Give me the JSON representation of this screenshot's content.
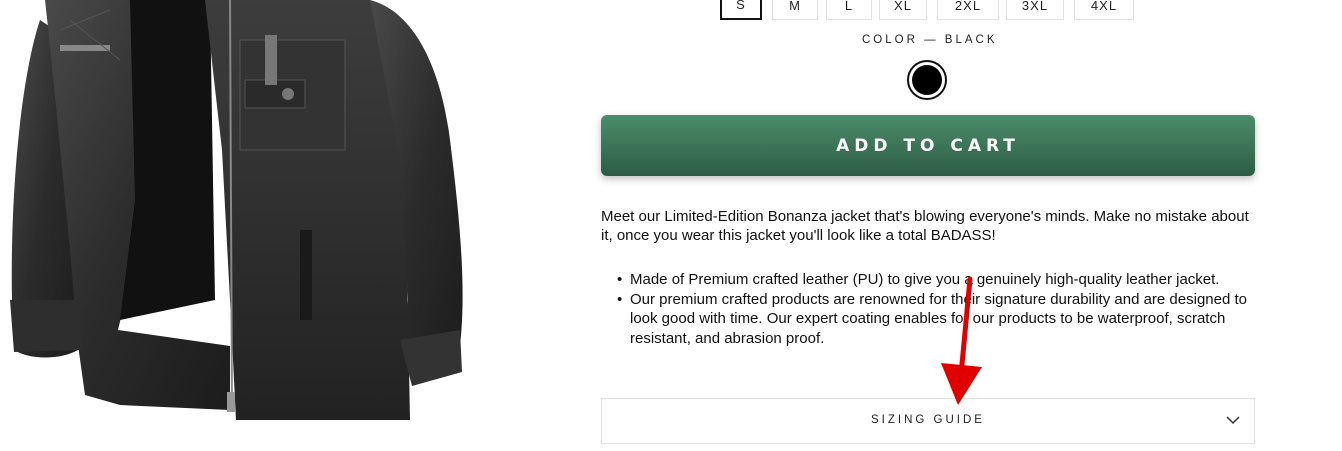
{
  "product": {
    "sizes": [
      {
        "label": "S",
        "selected": true
      },
      {
        "label": "M",
        "selected": false
      },
      {
        "label": "L",
        "selected": false
      },
      {
        "label": "XL",
        "selected": false
      },
      {
        "label": "2XL",
        "selected": false
      },
      {
        "label": "3XL",
        "selected": false
      },
      {
        "label": "4XL",
        "selected": false
      }
    ],
    "color_label": "COLOR — BLACK",
    "color_swatch": "#000000",
    "add_to_cart_label": "ADD TO CART",
    "description": "Meet our Limited-Edition Bonanza jacket that's blowing everyone's minds. Make no mistake about it, once you wear this jacket you'll look like a total BADASS!",
    "bullets": [
      "Made of Premium crafted leather (PU) to give you a genuinely high-quality leather jacket.",
      "Our premium crafted products are renowned for their signature durability and are designed to look good with time. Our expert coating enables for our products to be waterproof, scratch resistant, and abrasion proof."
    ],
    "sizing_guide_label": "SIZING GUIDE"
  },
  "colors": {
    "button_top": "#4c8d6b",
    "button_bottom": "#2d5c44",
    "annotation_arrow": "#e00000"
  },
  "icons": {
    "accordion": "chevron-down-icon",
    "annotation": "red-arrow-annotation"
  }
}
